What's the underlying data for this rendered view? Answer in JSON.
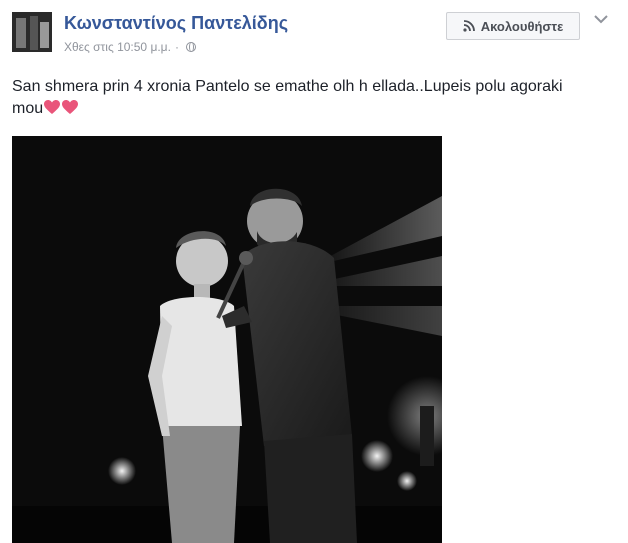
{
  "post": {
    "author": "Κωνσταντίνος Παντελίδης",
    "timestamp": "Χθες στις 10:50 μ.μ.",
    "separator": "·",
    "audience_icon": "globe-icon",
    "follow_label": "Ακολουθήστε",
    "follow_icon": "rss-icon",
    "options_icon": "chevron-down-icon",
    "text": "San shmera prin 4 xronia Pantelo se emathe olh h ellada..Lupeis polu agoraki mou",
    "emoji": [
      "heart-icon",
      "heart-icon"
    ],
    "heart_color": "#e9557a",
    "link_color": "#365899"
  }
}
